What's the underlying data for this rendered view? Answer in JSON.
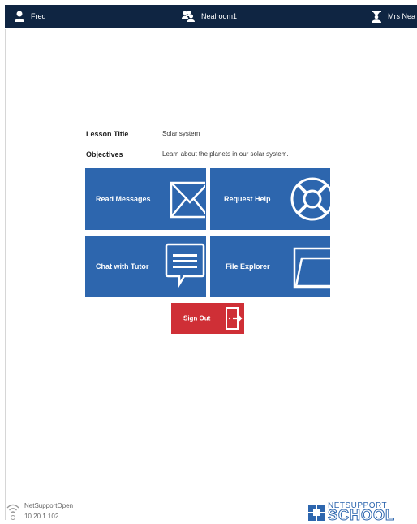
{
  "topbar": {
    "student_name": "Fred",
    "room_name": "Nealroom1",
    "teacher_name": "Mrs Nea"
  },
  "lesson": {
    "title_label": "Lesson Title",
    "title_value": "Solar system",
    "objectives_label": "Objectives",
    "objectives_value": "Learn about the planets in our solar system."
  },
  "tiles": {
    "read_messages": "Read Messages",
    "request_help": "Request Help",
    "chat_with_tutor": "Chat with Tutor",
    "file_explorer": "File Explorer"
  },
  "signout_label": "Sign Out",
  "footer": {
    "network_name": "NetSupportOpen",
    "ip_address": "10.20.1.102",
    "logo_top": "NETSUPPORT",
    "logo_bottom": "SCHOOL"
  },
  "colors": {
    "topbar": "#0f2542",
    "tile_blue": "#2d66ae",
    "signout_red": "#cf2f36"
  }
}
